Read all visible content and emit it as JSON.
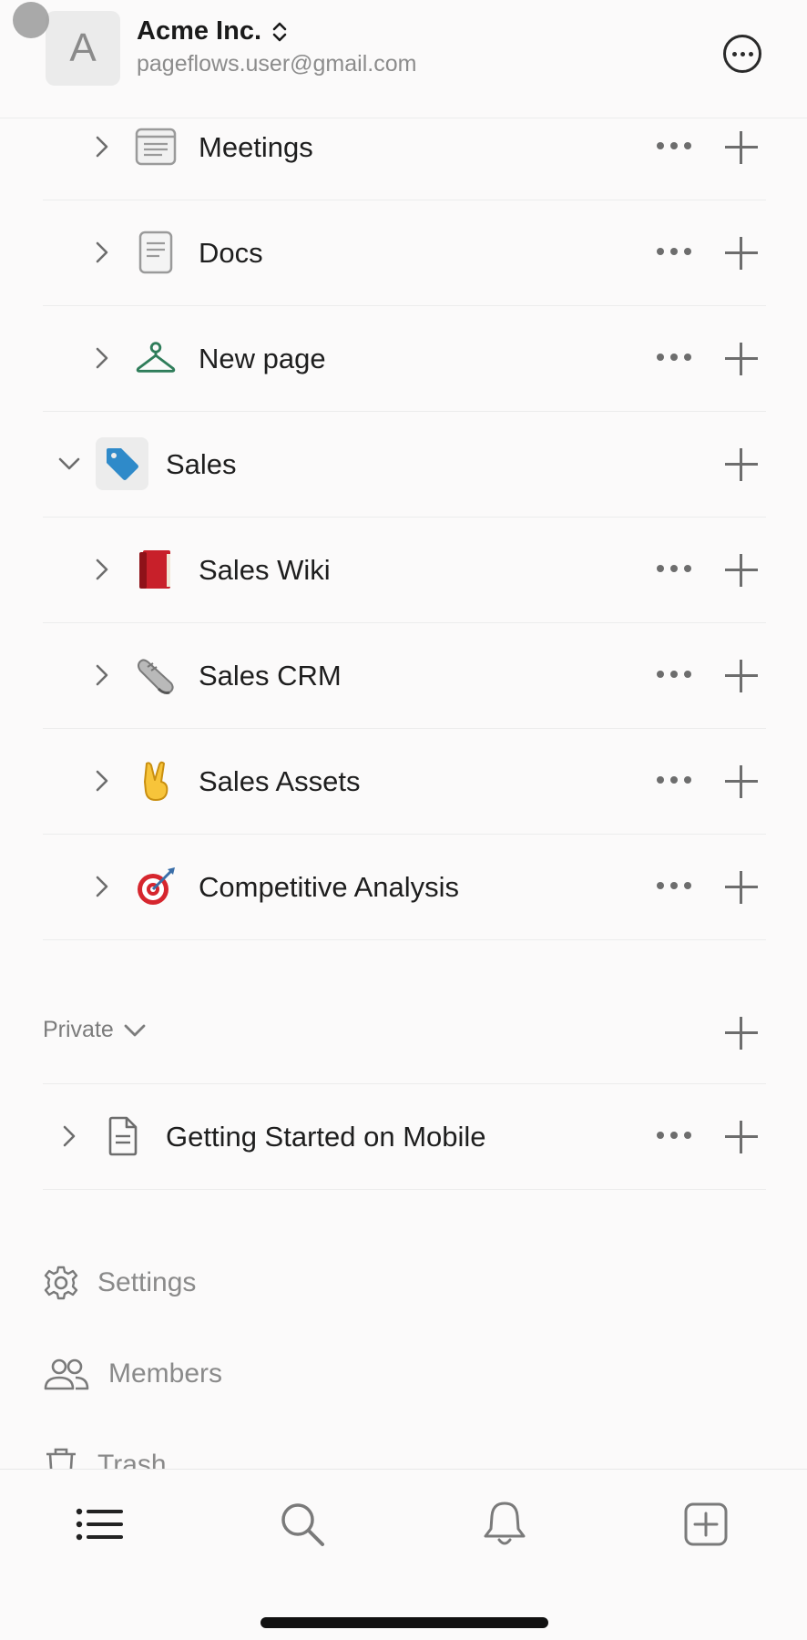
{
  "workspace": {
    "avatar_letter": "A",
    "name": "Acme Inc.",
    "email": "pageflows.user@gmail.com"
  },
  "pages": [
    {
      "label": "Meetings",
      "icon": "meetings-list-icon"
    },
    {
      "label": "Docs",
      "icon": "document-icon"
    },
    {
      "label": "New page",
      "icon": "hanger-icon"
    }
  ],
  "sales": {
    "label": "Sales",
    "icon": "tag-icon",
    "children": [
      {
        "label": "Sales Wiki",
        "icon": "red-book-icon"
      },
      {
        "label": "Sales CRM",
        "icon": "sneaker-icon"
      },
      {
        "label": "Sales Assets",
        "icon": "victory-hand-icon"
      },
      {
        "label": "Competitive Analysis",
        "icon": "target-icon"
      }
    ]
  },
  "private": {
    "label": "Private",
    "items": [
      {
        "label": "Getting Started on Mobile",
        "icon": "page-icon"
      }
    ]
  },
  "menu": {
    "settings": "Settings",
    "members": "Members",
    "trash": "Trash"
  },
  "tabbar": [
    "list-icon",
    "search-icon",
    "bell-icon",
    "new-page-icon"
  ]
}
